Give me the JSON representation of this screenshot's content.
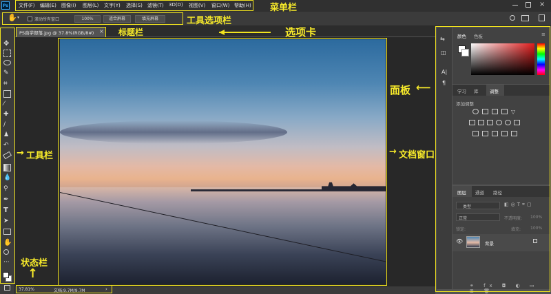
{
  "app": {
    "logo": "Ps"
  },
  "menu": [
    "文件(F)",
    "编辑(E)",
    "图像(I)",
    "图层(L)",
    "文字(Y)",
    "选择(S)",
    "滤镜(T)",
    "3D(D)",
    "视图(V)",
    "窗口(W)",
    "帮助(H)"
  ],
  "options": {
    "scroll_all_label": "滚动所有窗口",
    "zoom_100": "100%",
    "fit_screen": "适合屏幕",
    "fill_screen": "填充屏幕"
  },
  "document_tab": {
    "title": "PS自学部落.jpg @ 37.8%(RGB/8#)",
    "close": "×"
  },
  "status": {
    "zoom": "37.81%",
    "doc_info": "文档:9.7M/9.7M",
    "arrow": "›"
  },
  "panels": {
    "color": {
      "tabs": [
        "颜色",
        "色板"
      ]
    },
    "adjust": {
      "tabs": [
        "学习",
        "库",
        "调整"
      ],
      "title": "添加调整"
    },
    "layers": {
      "tabs": [
        "图层",
        "通道",
        "路径"
      ],
      "filter_kind": "类型",
      "blend_mode": "正常",
      "opacity_label": "不透明度:",
      "opacity_value": "100%",
      "lock_label": "锁定:",
      "fill_label": "填充:",
      "fill_value": "100%",
      "layer_name": "背景"
    }
  },
  "annotations": {
    "menubar": "菜单栏",
    "options_bar": "工具选项栏",
    "title_bar": "标题栏",
    "tabs": "选项卡",
    "panels": "面板",
    "toolbar": "工具栏",
    "doc_window": "文档窗口",
    "status_bar": "状态栏"
  },
  "colors": {
    "annotation": "#f2e41e",
    "ui_dark": "#303030",
    "panel": "#424242",
    "active_tab": "#4a4a4a"
  }
}
